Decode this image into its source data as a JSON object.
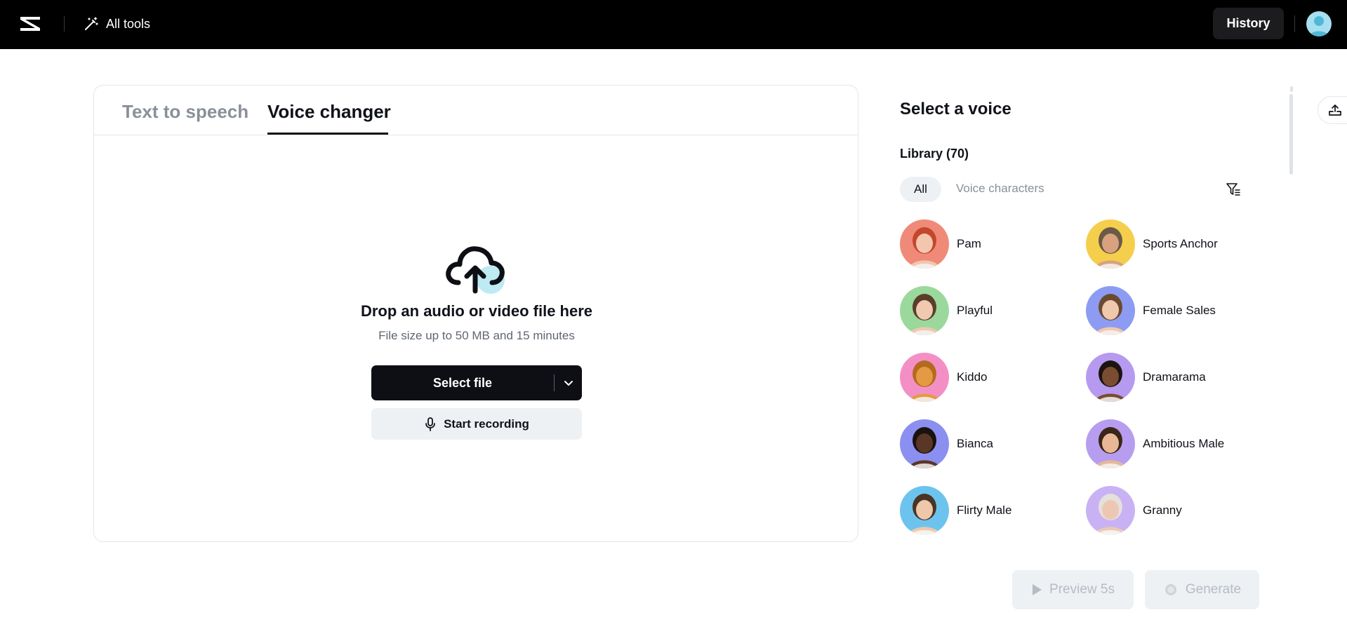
{
  "topbar": {
    "all_tools_label": "All tools",
    "history_label": "History"
  },
  "tabs": [
    {
      "label": "Text to speech",
      "active": false
    },
    {
      "label": "Voice changer",
      "active": true
    }
  ],
  "upload": {
    "title": "Drop an audio or video file here",
    "subtitle": "File size up to 50 MB and 15 minutes",
    "select_file_label": "Select file",
    "start_recording_label": "Start recording"
  },
  "voice_panel": {
    "title": "Select a voice",
    "library_label": "Library (70)",
    "filters": {
      "all": "All",
      "voice_characters": "Voice characters"
    },
    "voices": [
      {
        "name": "Pam",
        "bg": "#f08a78",
        "hair": "#c2472c",
        "skin": "#f3c6ae"
      },
      {
        "name": "Sports Anchor",
        "bg": "#f5cf4c",
        "hair": "#6b5a48",
        "skin": "#d9a17e"
      },
      {
        "name": "Playful",
        "bg": "#9ad99b",
        "hair": "#5a3d2a",
        "skin": "#efc9b0"
      },
      {
        "name": "Female Sales",
        "bg": "#8d9cf2",
        "hair": "#6a4a30",
        "skin": "#f0c8ad"
      },
      {
        "name": "Kiddo",
        "bg": "#f48fc6",
        "hair": "#b46a1e",
        "skin": "#e39a42"
      },
      {
        "name": "Dramarama",
        "bg": "#b69af0",
        "hair": "#1c1410",
        "skin": "#7a4c31"
      },
      {
        "name": "Bianca",
        "bg": "#8b8ff0",
        "hair": "#1a120e",
        "skin": "#5a3626"
      },
      {
        "name": "Ambitious Male",
        "bg": "#b79df0",
        "hair": "#3a2618",
        "skin": "#e8b896"
      },
      {
        "name": "Flirty Male",
        "bg": "#6cc4ee",
        "hair": "#4a3424",
        "skin": "#efc7aa"
      },
      {
        "name": "Granny",
        "bg": "#c9b2f3",
        "hair": "#e4e0dc",
        "skin": "#ecc8b2"
      }
    ]
  },
  "actions": {
    "preview_label": "Preview 5s",
    "generate_label": "Generate"
  }
}
